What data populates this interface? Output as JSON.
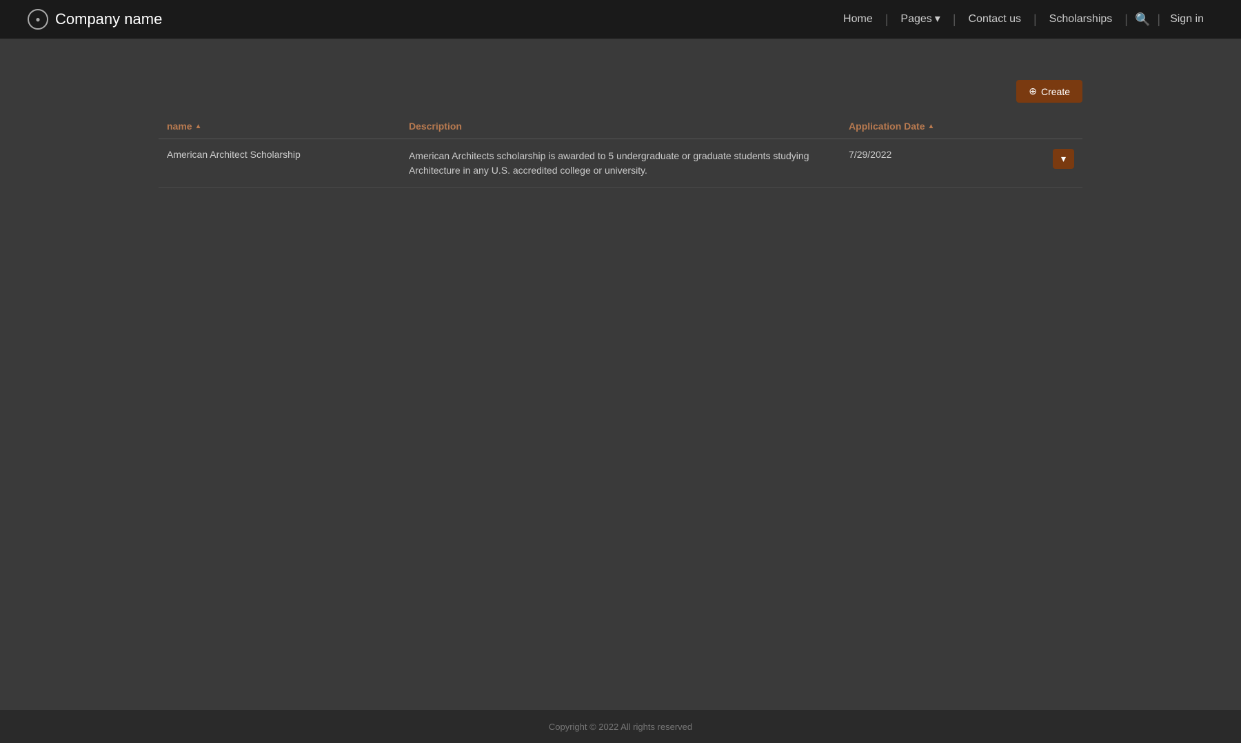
{
  "navbar": {
    "brand_icon": "●",
    "brand_name": "Company name",
    "nav_items": [
      {
        "label": "Home",
        "has_separator_before": false,
        "has_dropdown": false
      },
      {
        "label": "Pages",
        "has_separator_before": true,
        "has_dropdown": true
      },
      {
        "label": "Contact us",
        "has_separator_before": true,
        "has_dropdown": false
      },
      {
        "label": "Scholarships",
        "has_separator_before": true,
        "has_dropdown": false
      }
    ],
    "search_icon": "🔍",
    "signin_label": "Sign in"
  },
  "toolbar": {
    "create_button_label": "Create",
    "create_icon": "+"
  },
  "table": {
    "columns": [
      {
        "key": "name",
        "label": "name",
        "sortable": true
      },
      {
        "key": "description",
        "label": "Description",
        "sortable": false
      },
      {
        "key": "application_date",
        "label": "Application Date",
        "sortable": true
      }
    ],
    "rows": [
      {
        "name": "American Architect Scholarship",
        "description": "American Architects scholarship is awarded to 5 undergraduate or graduate students studying Architecture in any U.S. accredited college or university.",
        "application_date": "7/29/2022"
      }
    ]
  },
  "footer": {
    "copyright": "Copyright © 2022  All rights reserved"
  }
}
